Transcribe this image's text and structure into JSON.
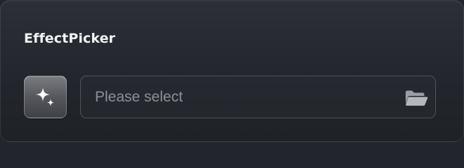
{
  "picker": {
    "title": "EffectPicker",
    "placeholder": "Please select"
  },
  "icons": {
    "effect": "sparkles-icon",
    "browse": "folder-open-icon"
  },
  "colors": {
    "background": "#22252b",
    "title_text": "#f2f3f5",
    "placeholder_text": "#8d9096",
    "icon": "#9b9ea4"
  }
}
